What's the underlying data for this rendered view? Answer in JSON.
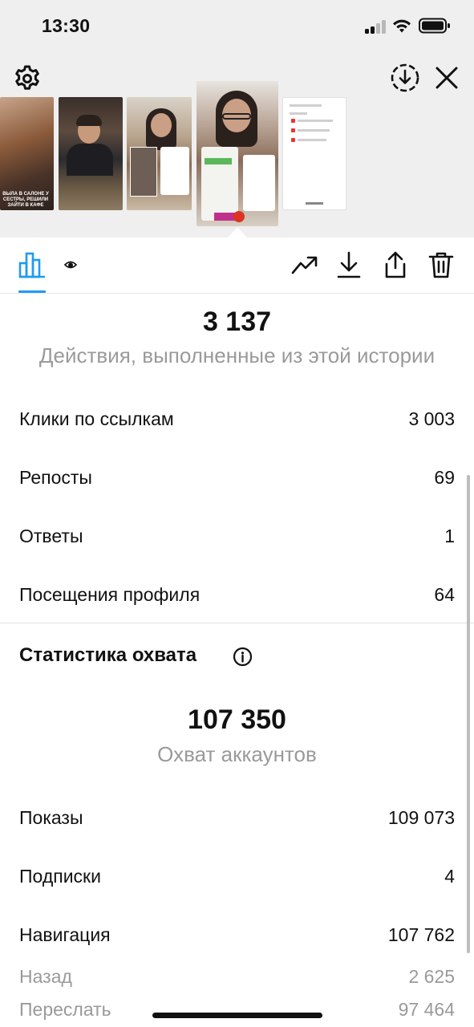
{
  "status_bar": {
    "time": "13:30"
  },
  "header": {
    "icons": {
      "settings": "gear-icon",
      "save": "download-circle-icon",
      "close": "close-icon"
    },
    "thumbnails": [
      {
        "caption": "ВЫЛА В САЛОНЕ У СЕСТРЫ, РЕШИЛИ ЗАЙТИ В КАФЕ"
      },
      {
        "caption": ""
      },
      {
        "caption": ""
      },
      {
        "caption": ""
      },
      {
        "caption": ""
      }
    ]
  },
  "toolbar": {
    "tabs": [
      {
        "name": "insights",
        "icon": "bar-chart-icon",
        "active": true
      },
      {
        "name": "viewers",
        "icon": "eye-icon",
        "active": false
      }
    ],
    "actions": [
      "trend-icon",
      "download-icon",
      "share-icon",
      "trash-icon"
    ]
  },
  "interactions": {
    "total": "3 137",
    "total_label": "Действия, выполненные из этой истории",
    "rows": [
      {
        "label": "Клики по ссылкам",
        "value": "3 003"
      },
      {
        "label": "Репосты",
        "value": "69"
      },
      {
        "label": "Ответы",
        "value": "1"
      },
      {
        "label": "Посещения профиля",
        "value": "64"
      }
    ]
  },
  "reach": {
    "title": "Статистика охвата",
    "total": "107 350",
    "total_label": "Охват аккаунтов",
    "rows": [
      {
        "label": "Показы",
        "value": "109 073"
      },
      {
        "label": "Подписки",
        "value": "4"
      },
      {
        "label": "Навигация",
        "value": "107 762"
      }
    ],
    "sub_rows": [
      {
        "label": "Назад",
        "value": "2 625"
      },
      {
        "label": "Переслать",
        "value": "97 464"
      }
    ]
  },
  "colors": {
    "accent": "#1f9bf0",
    "header_bg": "#efefef",
    "muted_text": "#9a9a9a"
  }
}
